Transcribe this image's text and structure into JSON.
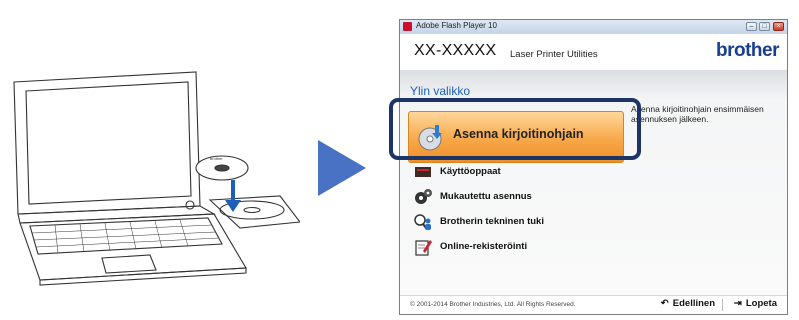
{
  "window": {
    "title": "Adobe Flash Player 10",
    "model": "XX-XXXXX",
    "product": "Laser Printer Utilities",
    "brand": "brother"
  },
  "menu": {
    "title": "Ylin valikko",
    "description": "Asenna kirjoitinohjain ensimmäisen asennuksen jälkeen.",
    "primary_button": "Asenna kirjoitinohjain",
    "items": [
      {
        "label": "Käyttöoppaat",
        "icon": "book-icon"
      },
      {
        "label": "Mukautettu asennus",
        "icon": "gears-icon"
      },
      {
        "label": "Brotherin tekninen tuki",
        "icon": "support-icon"
      },
      {
        "label": "Online-rekisteröinti",
        "icon": "registration-icon"
      }
    ]
  },
  "footer": {
    "copyright": "© 2001-2014 Brother Industries, Ltd. All Rights Reserved.",
    "back": "Edellinen",
    "exit": "Lopeta"
  },
  "colors": {
    "accent_blue": "#1d5fb8",
    "highlight_frame": "#1d3466",
    "button_orange": "#f7a84a",
    "arrow": "#4a72c4",
    "brand": "#1b3f8f"
  }
}
